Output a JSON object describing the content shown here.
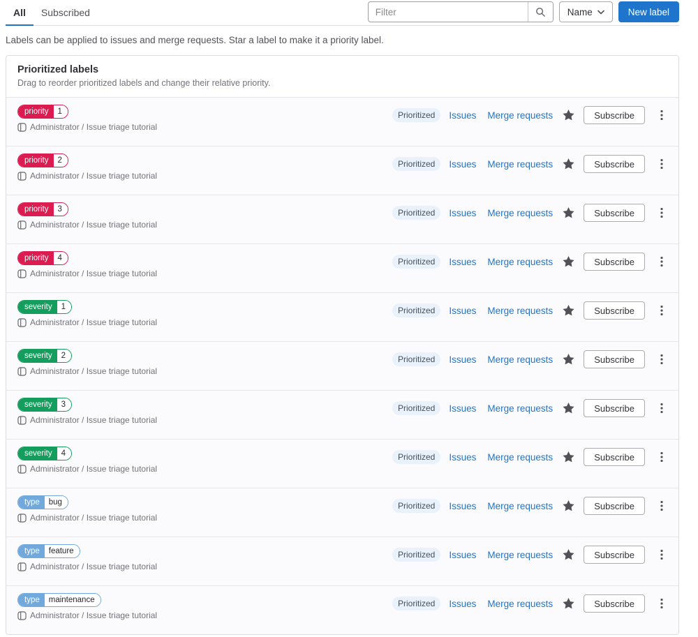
{
  "colors": {
    "accent": "#1f75cb",
    "link": "#1f75cb",
    "priority_red": "#dc1b50",
    "severity_green": "#149e5d",
    "type_blue": "#72a9dd",
    "prioritized_badge_bg": "#e9f1fb",
    "star_gray": "#535158"
  },
  "tabs": [
    {
      "label": "All",
      "active": true
    },
    {
      "label": "Subscribed",
      "active": false
    }
  ],
  "toolbar": {
    "filter_placeholder": "Filter",
    "filter_value": "",
    "sort_label": "Name",
    "new_label": "New label"
  },
  "description": "Labels can be applied to issues and merge requests. Star a label to make it a priority label.",
  "card": {
    "title": "Prioritized labels",
    "subtitle": "Drag to reorder prioritized labels and change their relative priority."
  },
  "row_common": {
    "project": "Administrator / Issue triage tutorial",
    "prioritized_badge": "Prioritized",
    "issues_link": "Issues",
    "merge_requests_link": "Merge requests",
    "subscribe_label": "Subscribe"
  },
  "labels": [
    {
      "scope": "priority",
      "value": "1",
      "color": "#dc1b50"
    },
    {
      "scope": "priority",
      "value": "2",
      "color": "#dc1b50"
    },
    {
      "scope": "priority",
      "value": "3",
      "color": "#dc1b50"
    },
    {
      "scope": "priority",
      "value": "4",
      "color": "#dc1b50"
    },
    {
      "scope": "severity",
      "value": "1",
      "color": "#149e5d"
    },
    {
      "scope": "severity",
      "value": "2",
      "color": "#149e5d"
    },
    {
      "scope": "severity",
      "value": "3",
      "color": "#149e5d"
    },
    {
      "scope": "severity",
      "value": "4",
      "color": "#149e5d"
    },
    {
      "scope": "type",
      "value": "bug",
      "color": "#72a9dd"
    },
    {
      "scope": "type",
      "value": "feature",
      "color": "#72a9dd"
    },
    {
      "scope": "type",
      "value": "maintenance",
      "color": "#72a9dd"
    }
  ]
}
